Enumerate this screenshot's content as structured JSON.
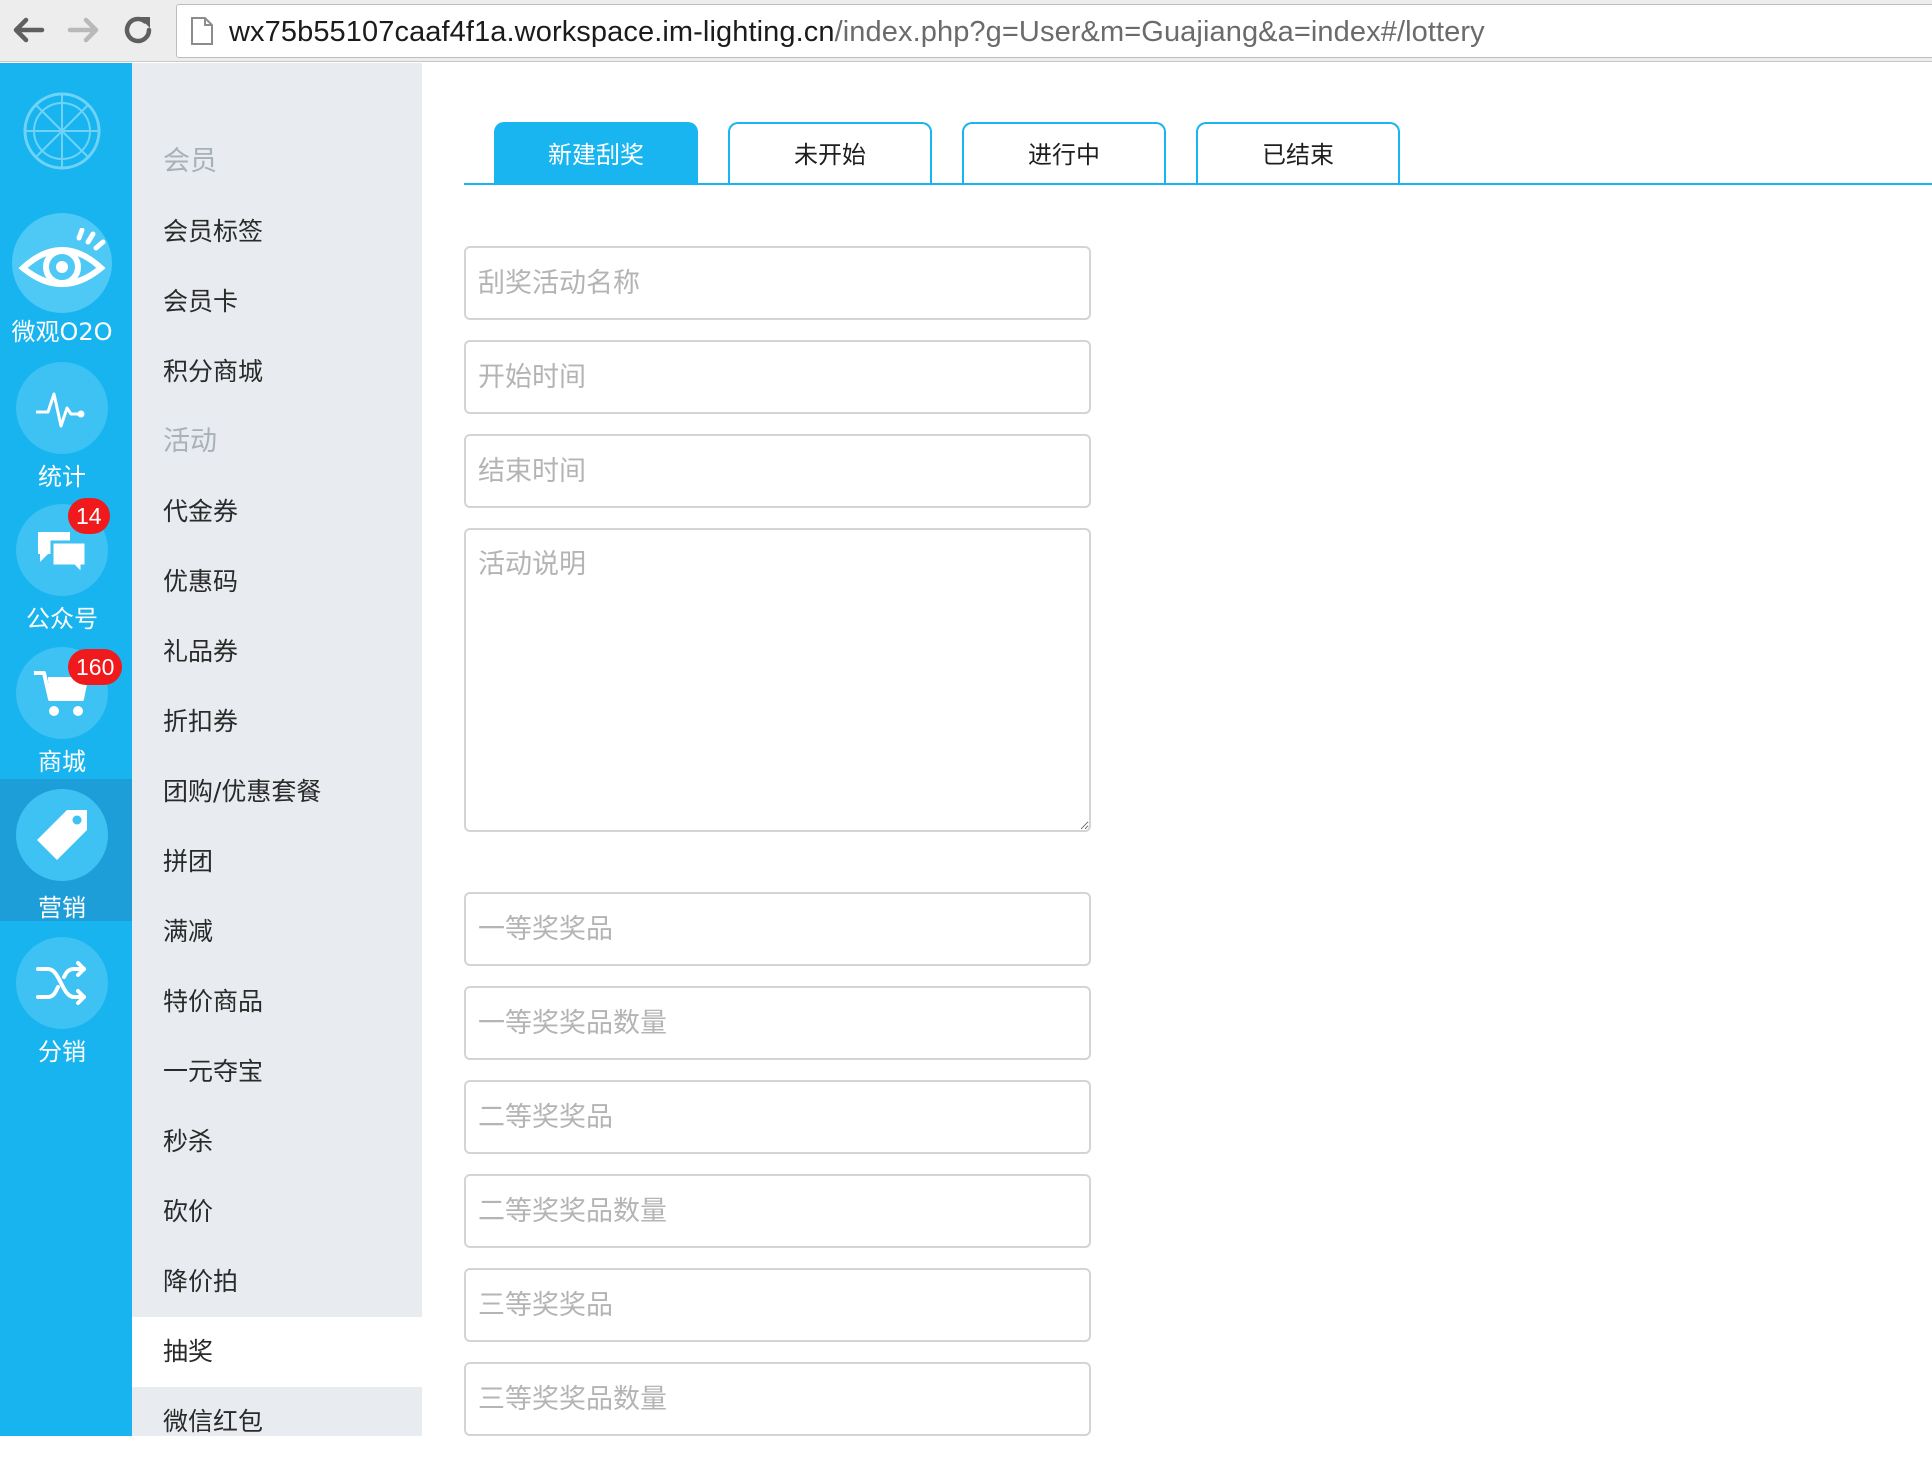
{
  "browser": {
    "url_host": "wx75b55107caaf4f1a.workspace.im-lighting.cn",
    "url_path": "/index.php?g=User&m=Guajiang&a=index#/lottery"
  },
  "rail": {
    "items": [
      {
        "label": "微观O2O",
        "icon": "eye-icon"
      },
      {
        "label": "统计",
        "icon": "pulse-icon"
      },
      {
        "label": "公众号",
        "icon": "chat-bubbles-icon",
        "badge": "14"
      },
      {
        "label": "商城",
        "icon": "cart-icon",
        "badge": "160"
      },
      {
        "label": "营销",
        "icon": "tag-icon",
        "active": true
      },
      {
        "label": "分销",
        "icon": "shuffle-icon"
      }
    ],
    "colors": {
      "background": "#17b4f0",
      "active": "#1d9ed8",
      "badge": "#f0191c"
    }
  },
  "submenu": {
    "items": [
      {
        "label": "会员",
        "heading": true
      },
      {
        "label": "会员标签"
      },
      {
        "label": "会员卡"
      },
      {
        "label": "积分商城"
      },
      {
        "label": "活动",
        "heading": true
      },
      {
        "label": "代金券"
      },
      {
        "label": "优惠码"
      },
      {
        "label": "礼品券"
      },
      {
        "label": "折扣券"
      },
      {
        "label": "团购/优惠套餐"
      },
      {
        "label": "拼团"
      },
      {
        "label": "满减"
      },
      {
        "label": "特价商品"
      },
      {
        "label": "一元夺宝"
      },
      {
        "label": "秒杀"
      },
      {
        "label": "砍价"
      },
      {
        "label": "降价拍"
      },
      {
        "label": "抽奖",
        "selected": true
      },
      {
        "label": "微信红包"
      }
    ]
  },
  "tabs": [
    {
      "label": "新建刮奖",
      "active": true
    },
    {
      "label": "未开始"
    },
    {
      "label": "进行中"
    },
    {
      "label": "已结束"
    }
  ],
  "form": {
    "name_placeholder": "刮奖活动名称",
    "start_placeholder": "开始时间",
    "end_placeholder": "结束时间",
    "desc_placeholder": "活动说明",
    "prize1_placeholder": "一等奖奖品",
    "prize1_qty_placeholder": "一等奖奖品数量",
    "prize2_placeholder": "二等奖奖品",
    "prize2_qty_placeholder": "二等奖奖品数量",
    "prize3_placeholder": "三等奖奖品",
    "prize3_qty_placeholder": "三等奖奖品数量"
  }
}
